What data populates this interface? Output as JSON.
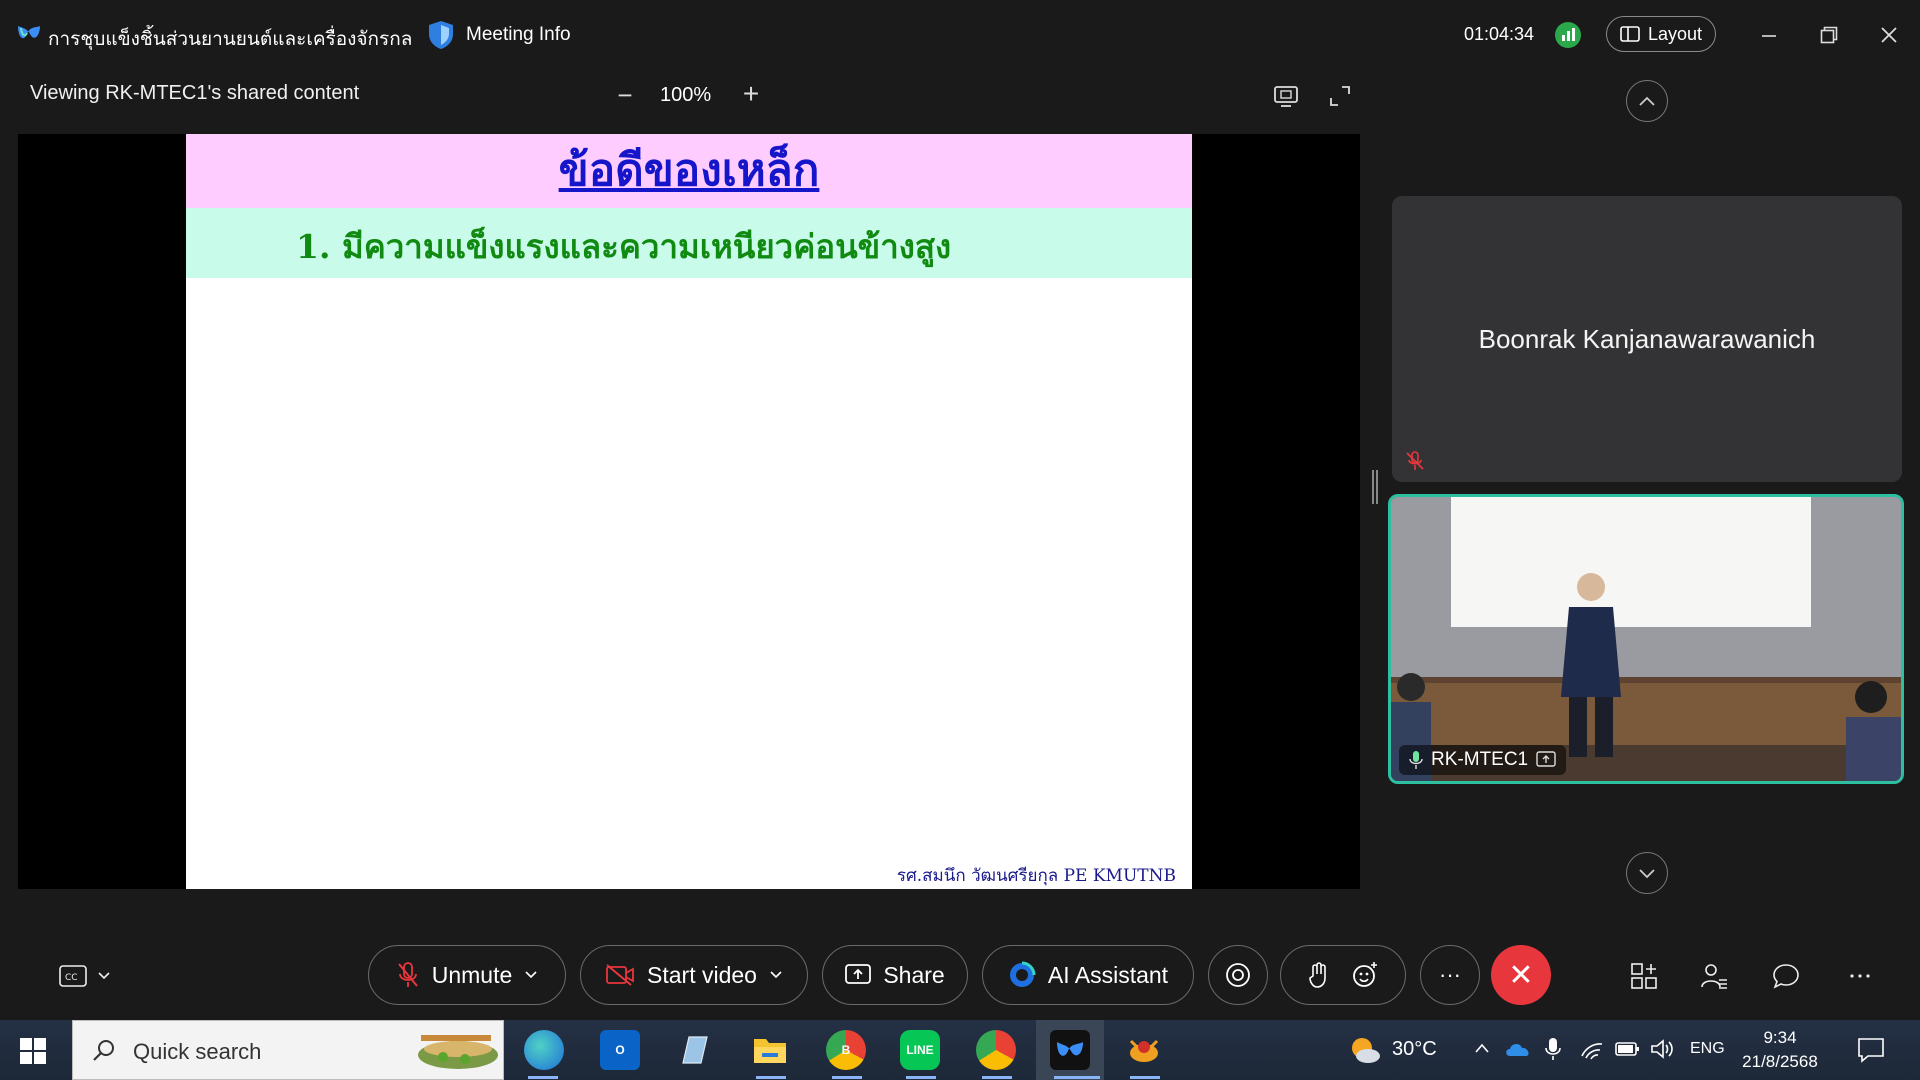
{
  "titlebar": {
    "meeting_title": "การชุบแข็งชิ้นส่วนยานยนต์และเครื่องจักรกล",
    "meeting_info_label": "Meeting Info",
    "timer": "01:04:34",
    "layout_label": "Layout"
  },
  "toolbar": {
    "viewing_label": "Viewing RK-MTEC1's shared content",
    "zoom_level": "100%",
    "zoom_out_symbol": "−",
    "zoom_in_symbol": "+"
  },
  "slide": {
    "title": "ข้อดีของเหล็ก",
    "point": "1. มีความแข็งแรงและความเหนียวค่อนข้างสูง",
    "footer": "รศ.สมนึก  วัฒนศรียกุล  PE   KMUTNB"
  },
  "participants": {
    "card_name": "Boonrak Kanjanawarawanich",
    "video_name": "RK-MTEC1"
  },
  "controls": {
    "unmute_label": "Unmute",
    "start_video_label": "Start video",
    "share_label": "Share",
    "ai_assistant_label": "AI Assistant",
    "more_symbol": "···",
    "end_symbol": "✕"
  },
  "taskbar": {
    "search_placeholder": "Quick search",
    "temperature": "30°C",
    "language": "ENG",
    "time": "9:34",
    "date": "21/8/2568"
  },
  "colors": {
    "end_call": "#e8363d",
    "active_speaker_border": "#2cbfa0",
    "slide_title_band": "#ffccff",
    "slide_point_band": "#c9fbeb",
    "slide_title_text": "#1515c9",
    "slide_point_text": "#118a11"
  }
}
